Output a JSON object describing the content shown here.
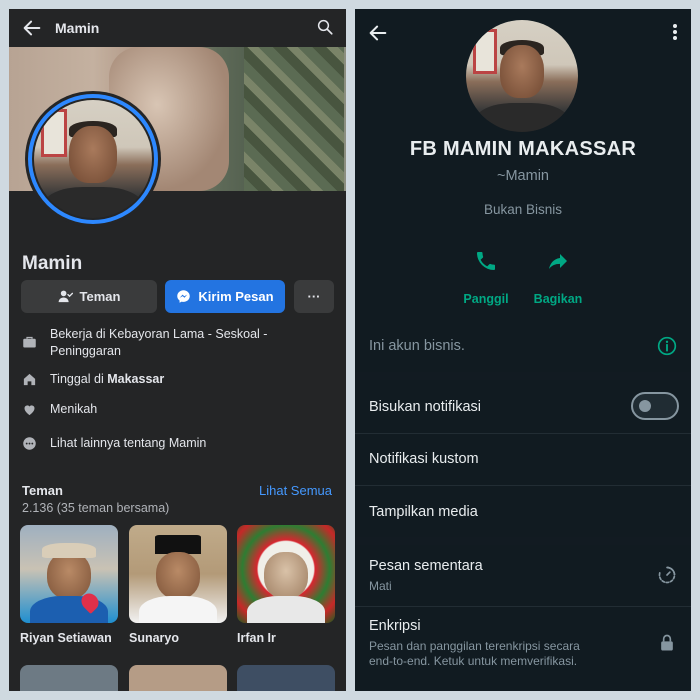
{
  "facebook": {
    "header": {
      "title": "Mamin"
    },
    "profile": {
      "name": "Mamin"
    },
    "buttons": {
      "friends": "Teman",
      "message": "Kirim Pesan",
      "more": "···"
    },
    "info": {
      "work": "Bekerja di Kebayoran Lama - Seskoal - Peninggaran",
      "lives_prefix": "Tinggal di ",
      "lives_city": "Makassar",
      "relationship": "Menikah",
      "see_more": "Lihat lainnya tentang Mamin"
    },
    "friends": {
      "title": "Teman",
      "count": "2.136 (35 teman bersama)",
      "see_all": "Lihat Semua",
      "items": [
        {
          "name": "Riyan Setiawan"
        },
        {
          "name": "Sunaryo"
        },
        {
          "name": "Irfan Ir"
        }
      ]
    },
    "colors": {
      "background": "#242526",
      "accent": "#2374e1",
      "link": "#4599ff"
    }
  },
  "whatsapp": {
    "contact": {
      "display_name": "FB MAMIN MAKASSAR",
      "push_name": "~Mamin",
      "business_status": "Bukan Bisnis"
    },
    "actions": {
      "call": "Panggil",
      "share": "Bagikan"
    },
    "business_note": "Ini akun bisnis.",
    "settings": {
      "mute": "Bisukan notifikasi",
      "mute_enabled": false,
      "custom_notifications": "Notifikasi kustom",
      "media": "Tampilkan media",
      "disappearing": "Pesan sementara",
      "disappearing_value": "Mati",
      "encryption": "Enkripsi",
      "encryption_desc_1": "Pesan dan panggilan terenkripsi secara",
      "encryption_desc_2": "end-to-end. Ketuk untuk memverifikasi."
    },
    "colors": {
      "background": "#111b21",
      "accent": "#00a884",
      "text_muted": "#8696a0"
    }
  }
}
